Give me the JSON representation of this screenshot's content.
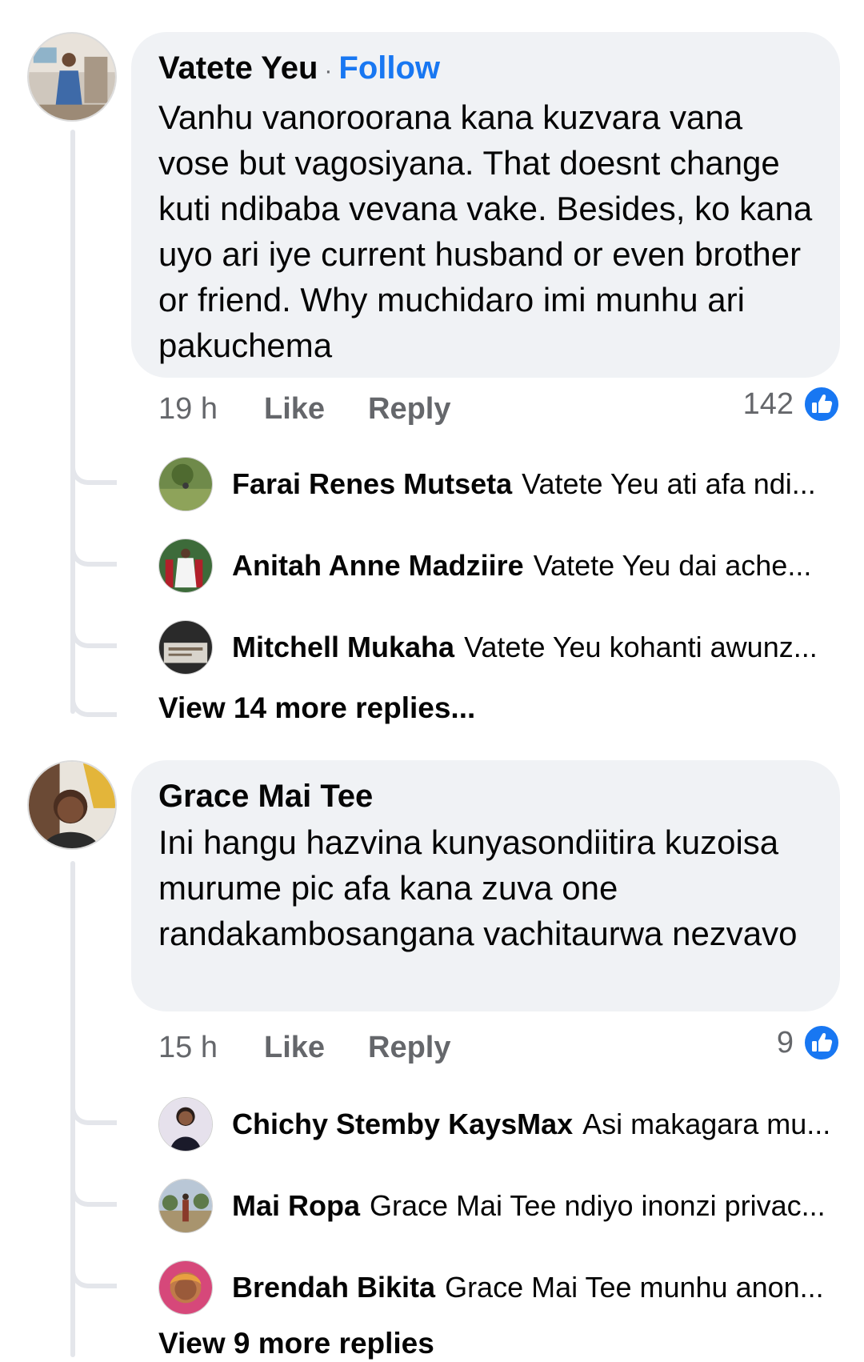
{
  "comments": [
    {
      "author": "Vatete Yeu",
      "separator": "·",
      "follow_label": "Follow",
      "text": "Vanhu vanoroorana kana kuzvara vana vose but vagosiyana. That doesnt change kuti ndibaba vevana vake. Besides, ko kana uyo ari iye current husband or even brother or friend. Why muchidaro imi munhu ari pakuchema",
      "time": "19 h",
      "like_label": "Like",
      "reply_label": "Reply",
      "reaction_count": "142",
      "replies": [
        {
          "name": "Farai Renes Mutseta",
          "snippet": "Vatete Yeu ati afa ndi..."
        },
        {
          "name": "Anitah Anne Madziire",
          "snippet": "Vatete Yeu dai ache..."
        },
        {
          "name": "Mitchell Mukaha",
          "snippet": "Vatete Yeu kohanti awunz..."
        }
      ],
      "view_more": "View 14 more replies..."
    },
    {
      "author": "Grace Mai Tee",
      "text": "Ini hangu hazvina kunyasondiitira kuzoisa murume pic afa kana zuva one randakambosangana vachitaurwa nezvavo",
      "time": "15 h",
      "like_label": "Like",
      "reply_label": "Reply",
      "reaction_count": "9",
      "replies": [
        {
          "name": "Chichy Stemby KaysMax",
          "snippet": "Asi makagara mu..."
        },
        {
          "name": "Mai Ropa",
          "snippet": "Grace Mai Tee ndiyo inonzi privac..."
        },
        {
          "name": "Brendah Bikita",
          "snippet": "Grace Mai Tee munhu anon..."
        }
      ],
      "view_more": "View 9 more replies"
    }
  ],
  "icons": {
    "reaction": "thumbs-up-icon"
  },
  "colors": {
    "link": "#1877f2",
    "bubble": "#f0f2f5",
    "meta": "#65676b"
  }
}
